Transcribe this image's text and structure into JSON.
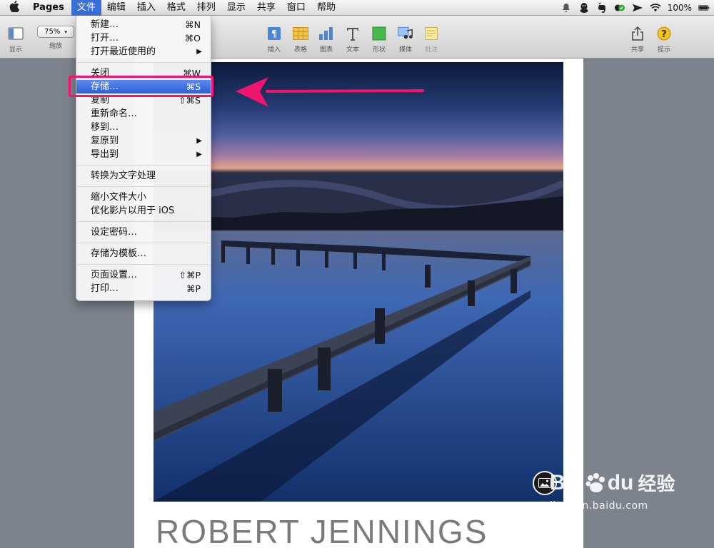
{
  "menubar": {
    "app_name": "Pages",
    "menus": [
      "文件",
      "编辑",
      "插入",
      "格式",
      "排列",
      "显示",
      "共享",
      "窗口",
      "帮助"
    ],
    "battery": "100%"
  },
  "toolbar": {
    "left": [
      {
        "label": "显示",
        "icon": "view-icon"
      },
      {
        "label": "缩放",
        "icon": "zoom-select",
        "value": "75%"
      }
    ],
    "center": [
      {
        "label": "插入",
        "icon": "insert-icon"
      },
      {
        "label": "表格",
        "icon": "table-icon"
      },
      {
        "label": "图表",
        "icon": "chart-icon"
      },
      {
        "label": "文本",
        "icon": "text-icon"
      },
      {
        "label": "形状",
        "icon": "shape-icon"
      },
      {
        "label": "媒体",
        "icon": "media-icon"
      },
      {
        "label": "批注",
        "icon": "comment-icon"
      }
    ],
    "right": [
      {
        "label": "共享",
        "icon": "share-icon"
      },
      {
        "label": "提示",
        "icon": "tips-icon"
      }
    ]
  },
  "file_menu": {
    "groups": [
      [
        {
          "label": "新建…",
          "shortcut": "⌘N"
        },
        {
          "label": "打开…",
          "shortcut": "⌘O"
        },
        {
          "label": "打开最近使用的",
          "submenu": true
        }
      ],
      [
        {
          "label": "关闭",
          "shortcut": "⌘W"
        },
        {
          "label": "存储…",
          "shortcut": "⌘S",
          "highlighted": true
        },
        {
          "label": "复制",
          "shortcut": "⇧⌘S"
        },
        {
          "label": "重新命名…"
        },
        {
          "label": "移到…"
        },
        {
          "label": "复原到",
          "submenu": true
        },
        {
          "label": "导出到",
          "submenu": true
        }
      ],
      [
        {
          "label": "转换为文字处理"
        }
      ],
      [
        {
          "label": "缩小文件大小"
        },
        {
          "label": "优化影片以用于 iOS"
        }
      ],
      [
        {
          "label": "设定密码…"
        }
      ],
      [
        {
          "label": "存储为模板…"
        }
      ],
      [
        {
          "label": "页面设置…",
          "shortcut": "⇧⌘P"
        },
        {
          "label": "打印…",
          "shortcut": "⌘P"
        }
      ]
    ]
  },
  "document": {
    "title": "ROBERT JENNINGS"
  },
  "watermark": {
    "brand": "Bai",
    "brand_suffix": "du",
    "brand_cn": "经验",
    "url": "jingyan.baidu.com"
  },
  "colors": {
    "accent": "#3b6fd8",
    "annotation": "#f0146e"
  }
}
